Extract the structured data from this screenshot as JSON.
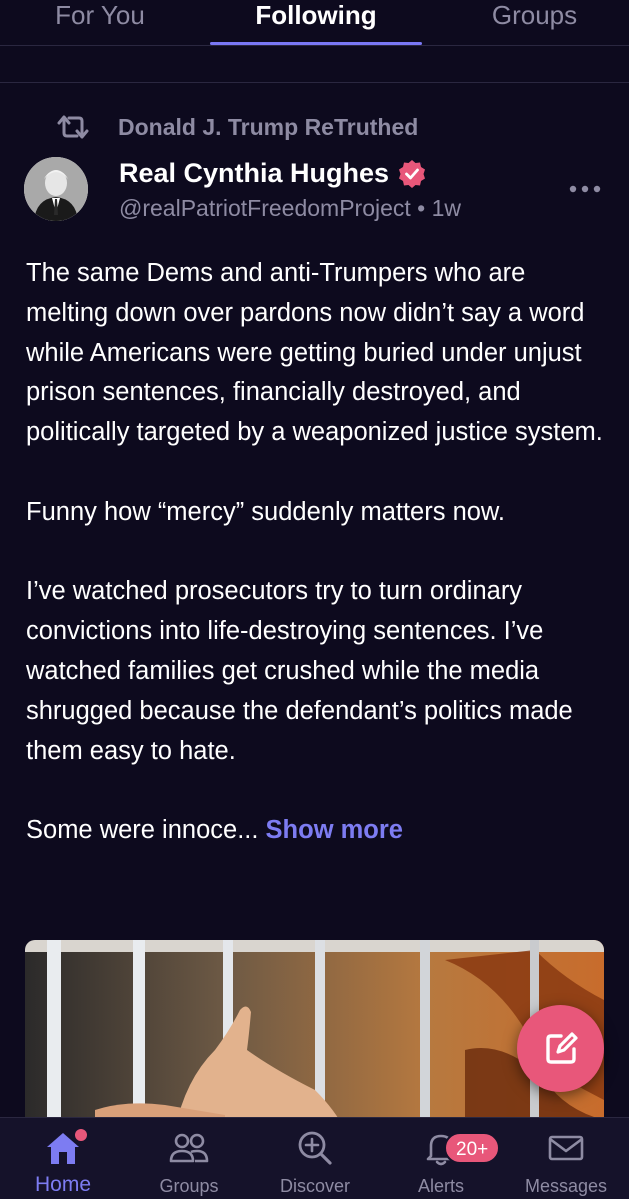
{
  "tabs": {
    "for_you": "For You",
    "following": "Following",
    "groups": "Groups"
  },
  "post": {
    "retruth_text": "Donald J. Trump ReTruthed",
    "author_name": "Real Cynthia Hughes",
    "author_handle": "@realPatriotFreedomProject • 1w",
    "paragraphs": [
      "The same Dems and anti-Trumpers who are melting down over pardons now didn’t say a word while Americans were getting buried under unjust prison sentences, financially destroyed, and politically targeted by a weaponized justice system.",
      "Funny how “mercy” suddenly matters now.",
      "I’ve watched prosecutors try to turn ordinary convictions into life-destroying sentences. I’ve watched families get crushed while the media shrugged because the defendant’s politics made them easy to hate."
    ],
    "truncated_text": "Some were innoce... ",
    "show_more": "Show more"
  },
  "bottom_nav": {
    "home": "Home",
    "groups": "Groups",
    "discover": "Discover",
    "alerts": "Alerts",
    "alerts_badge": "20+",
    "messages": "Messages"
  },
  "colors": {
    "background": "#0d0a1e",
    "accent": "#7d7cf2",
    "brand_pink": "#e8577a",
    "muted_text": "#8e8ba3"
  },
  "icons": {
    "retruth": "retruth-icon",
    "verified": "verified-badge-icon",
    "more": "more-options-icon",
    "compose": "compose-icon",
    "home": "home-icon",
    "groups": "groups-icon",
    "discover": "discover-icon",
    "alerts": "bell-icon",
    "messages": "envelope-icon"
  }
}
